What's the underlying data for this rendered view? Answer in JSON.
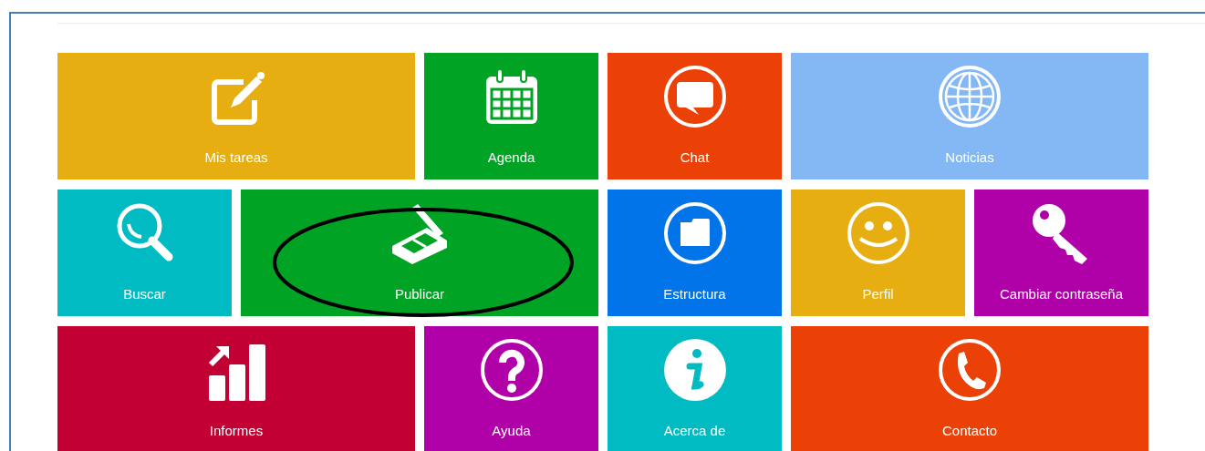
{
  "tiles": [
    {
      "label": "Mis tareas",
      "color": "#e6ae10",
      "circled": false
    },
    {
      "label": "Agenda",
      "color": "#00a324",
      "circled": false
    },
    {
      "label": "Chat",
      "color": "#eb4106",
      "circled": false
    },
    {
      "label": "Noticias",
      "color": "#84b8f4",
      "circled": false
    },
    {
      "label": "Buscar",
      "color": "#00bbc2",
      "circled": false
    },
    {
      "label": "Publicar",
      "color": "#00a324",
      "circled": true
    },
    {
      "label": "Estructura",
      "color": "#0074e8",
      "circled": false
    },
    {
      "label": "Perfil",
      "color": "#e6ae10",
      "circled": false
    },
    {
      "label": "Cambiar contraseña",
      "color": "#b000a8",
      "circled": false
    },
    {
      "label": "Informes",
      "color": "#c30033",
      "circled": false
    },
    {
      "label": "Ayuda",
      "color": "#b000a8",
      "circled": false
    },
    {
      "label": "Acerca de",
      "color": "#00bbc2",
      "circled": false
    },
    {
      "label": "Contacto",
      "color": "#eb4106",
      "circled": false
    }
  ]
}
